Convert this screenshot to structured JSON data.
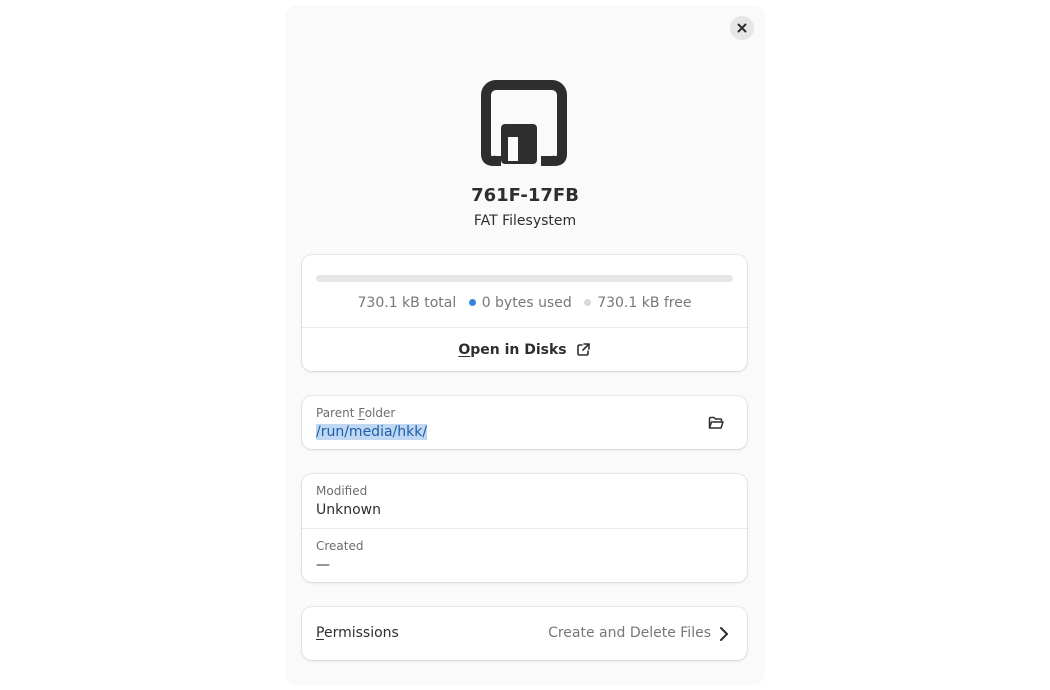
{
  "dialog": {
    "close_icon": "close-icon",
    "drive_icon": "drive-removable-icon",
    "title": "761F-17FB",
    "subtitle": "FAT Filesystem"
  },
  "usage": {
    "used_fraction": 0,
    "total": "730.1 kB total",
    "used": "0 bytes used",
    "free": "730.1 kB free",
    "used_color": "#3584e4",
    "free_color": "#d9d9d9",
    "open_disks_mnemonic": "O",
    "open_disks_rest": "pen in Disks",
    "open_disks_icon": "external-link-icon"
  },
  "parent_folder": {
    "label_before": "Parent ",
    "label_mnemonic": "F",
    "label_after": "older",
    "value": "/run/media/hkk/",
    "folder_icon": "folder-open-icon"
  },
  "dates": {
    "modified_label": "Modified",
    "modified_value": "Unknown",
    "created_label": "Created",
    "created_value": "—"
  },
  "permissions": {
    "label_mnemonic": "P",
    "label_rest": "ermissions",
    "value": "Create and Delete Files",
    "chevron_icon": "chevron-right-icon"
  }
}
